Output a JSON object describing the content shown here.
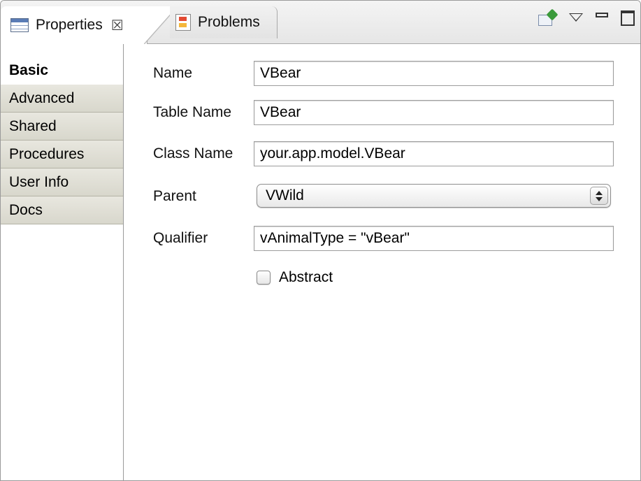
{
  "tabs": {
    "properties_label": "Properties",
    "problems_label": "Problems",
    "close_glyph": "☒"
  },
  "sidebar": {
    "items": [
      {
        "label": "Basic"
      },
      {
        "label": "Advanced"
      },
      {
        "label": "Shared"
      },
      {
        "label": "Procedures"
      },
      {
        "label": "User Info"
      },
      {
        "label": "Docs"
      }
    ]
  },
  "form": {
    "name": {
      "label": "Name",
      "value": "VBear"
    },
    "table_name": {
      "label": "Table Name",
      "value": "VBear"
    },
    "class_name": {
      "label": "Class Name",
      "value": "your.app.model.VBear"
    },
    "parent": {
      "label": "Parent",
      "value": "VWild"
    },
    "qualifier": {
      "label": "Qualifier",
      "value": "vAnimalType = \"vBear\""
    },
    "abstract": {
      "label": "Abstract",
      "checked": false
    }
  },
  "icons": {
    "properties_tab": "properties-table-icon",
    "problems_tab": "problems-icon",
    "pin": "pin-editor-icon",
    "view_menu": "view-menu-icon",
    "minimize": "minimize-icon",
    "maximize": "maximize-icon"
  }
}
